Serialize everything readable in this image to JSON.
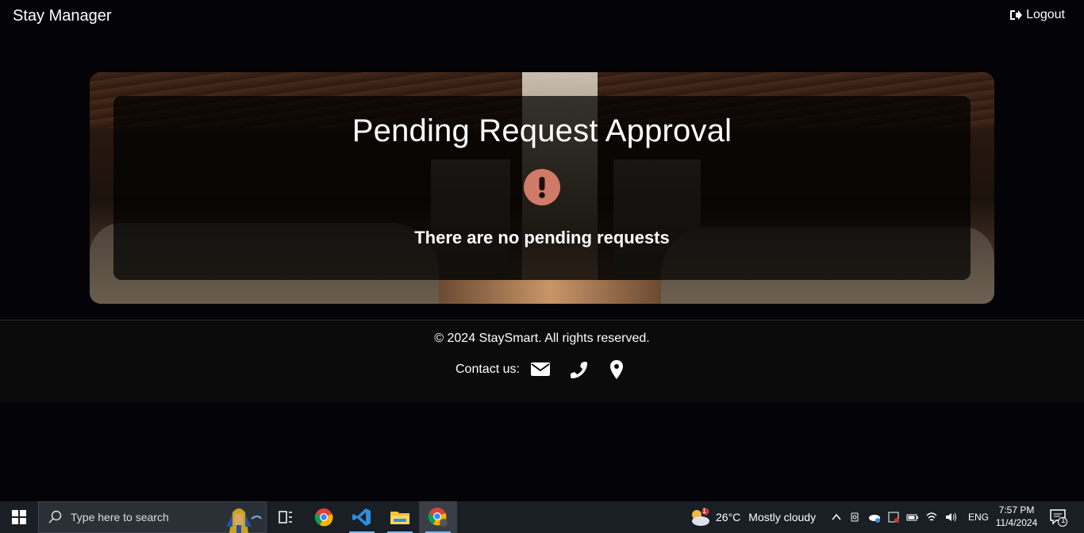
{
  "navbar": {
    "brand": "Stay Manager",
    "logout_label": "Logout"
  },
  "hero": {
    "title": "Pending Request Approval",
    "icon": "exclamation-circle-icon",
    "message": "There are no pending requests",
    "icon_color": "#d07a68"
  },
  "footer": {
    "copyright": "© 2024 StaySmart. All rights reserved.",
    "contact_label": "Contact us:",
    "contact_icons": [
      "envelope-icon",
      "phone-icon",
      "map-marker-icon"
    ]
  },
  "taskbar": {
    "search_placeholder": "Type here to search",
    "apps": [
      "task-view-icon",
      "chrome-icon",
      "vscode-icon",
      "file-explorer-icon",
      "chrome-profile-icon"
    ],
    "weather_temp": "26°C",
    "weather_desc": "Mostly cloudy",
    "weather_badge": "1",
    "language": "ENG",
    "time": "7:57 PM",
    "date": "11/4/2024",
    "notification_count": "1"
  }
}
